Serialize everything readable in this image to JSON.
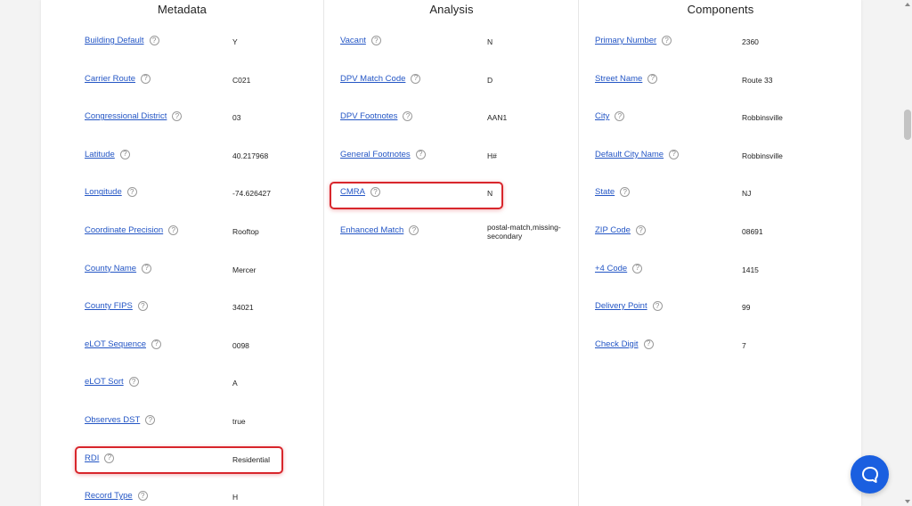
{
  "columns": {
    "metadata": {
      "title": "Metadata",
      "rows": [
        {
          "label": "Building Default",
          "value": "Y"
        },
        {
          "label": "Carrier Route",
          "value": "C021"
        },
        {
          "label": "Congressional District",
          "value": "03"
        },
        {
          "label": "Latitude",
          "value": "40.217968"
        },
        {
          "label": "Longitude",
          "value": "-74.626427"
        },
        {
          "label": "Coordinate Precision",
          "value": "Rooftop"
        },
        {
          "label": "County Name",
          "value": "Mercer"
        },
        {
          "label": "County FIPS",
          "value": "34021"
        },
        {
          "label": "eLOT Sequence",
          "value": "0098"
        },
        {
          "label": "eLOT Sort",
          "value": "A"
        },
        {
          "label": "Observes DST",
          "value": "true"
        },
        {
          "label": "RDI",
          "value": "Residential"
        },
        {
          "label": "Record Type",
          "value": "H"
        }
      ]
    },
    "analysis": {
      "title": "Analysis",
      "rows": [
        {
          "label": "Vacant",
          "value": "N"
        },
        {
          "label": "DPV Match Code",
          "value": "D"
        },
        {
          "label": "DPV Footnotes",
          "value": "AAN1"
        },
        {
          "label": "General Footnotes",
          "value": "H#"
        },
        {
          "label": "CMRA",
          "value": "N"
        },
        {
          "label": "Enhanced Match",
          "value": "postal-match,missing-secondary"
        }
      ]
    },
    "components": {
      "title": "Components",
      "rows": [
        {
          "label": "Primary Number",
          "value": "2360"
        },
        {
          "label": "Street Name",
          "value": "Route 33"
        },
        {
          "label": "City",
          "value": "Robbinsville"
        },
        {
          "label": "Default City Name",
          "value": "Robbinsville"
        },
        {
          "label": "State",
          "value": "NJ"
        },
        {
          "label": "ZIP Code",
          "value": "08691"
        },
        {
          "label": "+4 Code",
          "value": "1415"
        },
        {
          "label": "Delivery Point",
          "value": "99"
        },
        {
          "label": "Check Digit",
          "value": "7"
        }
      ]
    }
  },
  "help_glyph": "?",
  "colors": {
    "link": "#2456c5",
    "highlight": "#d8262c",
    "chat_button": "#1a5fe0"
  },
  "icons": {
    "help": "question-circle-icon",
    "chat": "chat-bubble-icon"
  }
}
